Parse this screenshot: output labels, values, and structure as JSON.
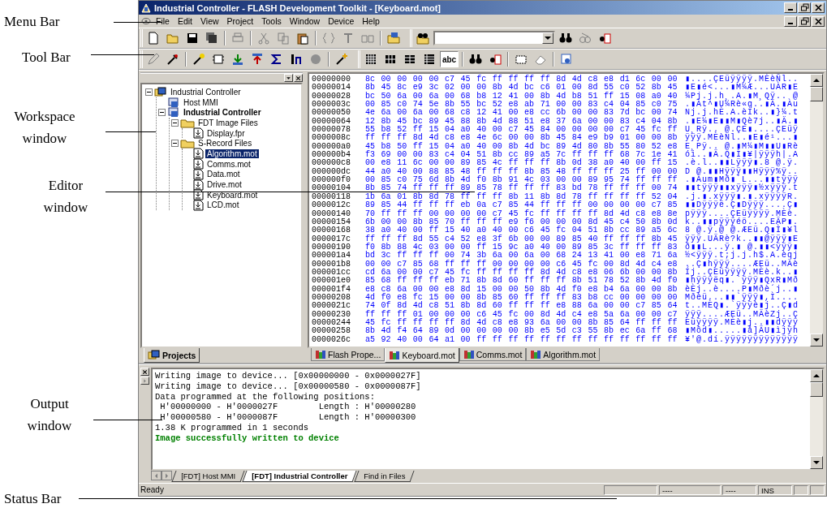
{
  "annotations": [
    {
      "label": "Menu Bar"
    },
    {
      "label": "Tool Bar"
    },
    {
      "label": "Workspace window"
    },
    {
      "label": "Editor window"
    },
    {
      "label": "Output window"
    },
    {
      "label": "Status Bar"
    }
  ],
  "window": {
    "title": "Industrial Controller - FLASH Development Toolkit - [Keyboard.mot]"
  },
  "menu": [
    "File",
    "Edit",
    "View",
    "Project",
    "Tools",
    "Window",
    "Device",
    "Help"
  ],
  "toolbar": {
    "abc_button": {
      "label": "abc",
      "selected": true
    }
  },
  "workspace": {
    "tree": [
      {
        "label": "Industrial Controller",
        "kind": "workspace",
        "active": false,
        "selected": false,
        "expanded": true,
        "children": [
          {
            "label": "Host MMI",
            "kind": "project",
            "active": false,
            "selected": false
          },
          {
            "label": "Industrial Controller",
            "kind": "project",
            "active": true,
            "selected": false,
            "expanded": true,
            "children": [
              {
                "label": "FDT Image Files",
                "kind": "folder",
                "active": false,
                "selected": false,
                "expanded": true,
                "children": [
                  {
                    "label": "Display.fpr",
                    "kind": "file",
                    "active": false,
                    "selected": false
                  }
                ]
              },
              {
                "label": "S-Record Files",
                "kind": "folder",
                "active": false,
                "selected": false,
                "expanded": true,
                "children": [
                  {
                    "label": "Algorithm.mot",
                    "kind": "file",
                    "active": false,
                    "selected": true
                  },
                  {
                    "label": "Comms.mot",
                    "kind": "file",
                    "active": false,
                    "selected": false
                  },
                  {
                    "label": "Data.mot",
                    "kind": "file",
                    "active": false,
                    "selected": false
                  },
                  {
                    "label": "Drive.mot",
                    "kind": "file",
                    "active": false,
                    "selected": false
                  },
                  {
                    "label": "Keyboard.mot",
                    "kind": "file",
                    "active": false,
                    "selected": false
                  },
                  {
                    "label": "LCD.mot",
                    "kind": "file",
                    "active": false,
                    "selected": false
                  }
                ]
              }
            ]
          }
        ]
      }
    ],
    "tabs": [
      {
        "label": "Projects",
        "selected": true
      }
    ]
  },
  "editor": {
    "rows": [
      {
        "address": "00000000",
        "bytes": "8c 00 00 00 00 c7 45 fc ff ff ff ff 8d 4d c8 e8 d1 6c 00 00",
        "ascii": "▮....ÇEüÿÿÿÿ.MÈèÑl.."
      },
      {
        "address": "00000014",
        "bytes": "8b 45 8c e9 3c 02 00 00 8b 4d bc c6 01 00 8d 55 c0 52 8b 45",
        "ascii": "▮E▮é<...▮M¼Æ...UÀR▮E"
      },
      {
        "address": "00000028",
        "bytes": "bc 50 6a 00 6a 00 68 b8 12 41 00 8b 4d b8 51 ff 15 08 a0 40",
        "ascii": "¼Pj.j.h¸.A.▮M¸Qÿ.. @"
      },
      {
        "address": "0000003c",
        "bytes": "00 85 c0 74 5e 8b 55 bc 52 e8 ab 71 00 00 83 c4 04 85 c0 75",
        "ascii": ".▮Àt^▮U¼Rè«q..▮Ä.▮Àu"
      },
      {
        "address": "00000050",
        "bytes": "4e 6a 00 6a 00 68 c8 12 41 00 e8 cc 6b 00 00 83 7d bc 00 74",
        "ascii": "Nj.j.hÈ.A.èÌk..▮}¼.t"
      },
      {
        "address": "00000064",
        "bytes": "12 8b 45 bc 89 45 88 8b 4d 88 51 e8 37 6a 00 00 83 c4 04 8b",
        "ascii": ".▮E¼▮E▮▮M▮Qè7j..▮Ä.▮"
      },
      {
        "address": "00000078",
        "bytes": "55 b8 52 ff 15 04 a0 40 00 c7 45 84 00 00 00 00 c7 45 fc ff",
        "ascii": "U¸Rÿ.. @.ÇE▮....ÇEüÿ"
      },
      {
        "address": "0000008c",
        "bytes": "ff ff ff 8d 4d c8 e8 4e 6c 00 00 8b 45 84 e9 b9 01 00 00 8b",
        "ascii": "ÿÿÿ.MÈèNl..▮E▮é¹...▮"
      },
      {
        "address": "000000a0",
        "bytes": "45 b8 50 ff 15 04 a0 40 00 8b 4d bc 89 4d 80 8b 55 80 52 e8",
        "ascii": "E¸Pÿ.. @.▮M¼▮M▮▮U▮Rè"
      },
      {
        "address": "000000b4",
        "bytes": "f3 69 00 00 83 c4 04 51 8b cc 89 a5 7c ff ff ff 68 7c 1e 41",
        "ascii": "ói..▮Ä.Q▮Ì▮¥|ÿÿÿh|.A"
      },
      {
        "address": "000000c8",
        "bytes": "00 e8 11 6c 00 00 89 85 4c ff ff ff 8b 0d 38 a0 40 00 ff 15",
        "ascii": ".è.l..▮▮Lÿÿÿ▮.8 @.ÿ."
      },
      {
        "address": "000000dc",
        "bytes": "44 a0 40 00 88 85 48 ff ff ff 8b 85 48 ff ff ff 25 ff 00 00",
        "ascii": "D @.▮▮Hÿÿÿ▮▮Hÿÿÿ%ÿ.."
      },
      {
        "address": "000000f0",
        "bytes": "00 85 c0 75 6d 8b 4d f0 8b 91 4c 03 00 00 89 95 74 ff ff ff",
        "ascii": ".▮Àum▮Mð▮´L...▮▮tÿÿÿ"
      },
      {
        "address": "00000104",
        "bytes": "8b 85 74 ff ff ff 89 85 78 ff ff ff 83 bd 78 ff ff ff 00 74",
        "ascii": "▮▮tÿÿÿ▮▮xÿÿÿ▮½xÿÿÿ.t"
      },
      {
        "address": "00000118",
        "bytes": "1b 6a 01 8b 8d 78 ff ff ff 8b 11 8b 8d 78 ff ff ff ff 52 04",
        "ascii": ".j.▮.xÿÿÿ▮.▮.xÿÿÿÿR."
      },
      {
        "address": "0000012c",
        "bytes": "89 85 44 ff ff ff eb 0a c7 85 44 ff ff ff 00 00 00 00 c7 85",
        "ascii": "▮▮Dÿÿÿë.Ç▮Dÿÿÿ....Ç▮"
      },
      {
        "address": "00000140",
        "bytes": "70 ff ff ff 00 00 00 00 c7 45 fc ff ff ff ff 8d 4d c8 e8 8e",
        "ascii": "pÿÿÿ....ÇEüÿÿÿÿ.MÈè."
      },
      {
        "address": "00000154",
        "bytes": "6b 00 00 8b 85 70 ff ff ff e9 f6 00 00 00 8d 45 c4 50 8b 0d",
        "ascii": "k..▮▮pÿÿÿéö....EÄP▮."
      },
      {
        "address": "00000168",
        "bytes": "38 a0 40 00 ff 15 40 a0 40 00 c6 45 fc 04 51 8b cc 89 a5 6c",
        "ascii": "8 @.ÿ.@ @.ÆEü.Q▮Ì▮¥l"
      },
      {
        "address": "0000017c",
        "bytes": "ff ff ff 8d 55 c4 52 e8 3f 6b 00 00 89 85 40 ff ff ff 8b 45",
        "ascii": "ÿÿÿ.UÄRè?k..▮▮@ÿÿÿ▮E"
      },
      {
        "address": "00000190",
        "bytes": "f0 8b 88 4c 03 00 00 ff 15 9c a0 40 00 89 85 3c ff ff ff 83",
        "ascii": "ð▮▮L...ÿ.▮ @.▮▮<ÿÿÿ▮"
      },
      {
        "address": "000001a4",
        "bytes": "bd 3c ff ff ff 00 74 3b 6a 00 6a 00 68 24 13 41 00 e8 71 6a",
        "ascii": "½<ÿÿÿ.t;j.j.h$.A.èqj"
      },
      {
        "address": "000001b8",
        "bytes": "00 00 c7 85 68 ff ff ff 00 00 00 00 c6 45 fc 00 8d 4d c4 e8",
        "ascii": "..Ç▮hÿÿÿ....ÆEü..MÄè"
      },
      {
        "address": "000001cc",
        "bytes": "cd 6a 00 00 c7 45 fc ff ff ff ff 8d 4d c8 e8 06 6b 00 00 8b",
        "ascii": "Íj..ÇEüÿÿÿÿ.MÈè.k..▮"
      },
      {
        "address": "000001e0",
        "bytes": "85 68 ff ff ff eb 71 8b 8d 60 ff ff ff 8b 51 78 52 8b 4d f0",
        "ascii": "▮hÿÿÿëq▮.`ÿÿÿ▮QxR▮Mð"
      },
      {
        "address": "000001f4",
        "bytes": "e8 c8 6a 00 00 e8 8d 15 00 00 50 8b 4d f0 e8 b4 6a 00 00 8b",
        "ascii": "èÈj..è....P▮Mðè´j..▮"
      },
      {
        "address": "00000208",
        "bytes": "4d f0 e8 fc 15 00 00 8b 85 60 ff ff ff 83 b8 cc 00 00 00 00",
        "ascii": "Mðèü...▮▮`ÿÿÿ▮,Ì...."
      },
      {
        "address": "0000021c",
        "bytes": "74 0f 8d 4d c8 51 8b 8d 60 ff ff ff e8 88 6a 00 00 c7 85 64",
        "ascii": "t..MÈQ▮.`ÿÿÿè▮j..Ç▮d"
      },
      {
        "address": "00000230",
        "bytes": "ff ff ff 01 00 00 00 c6 45 fc 00 8d 4d c4 e8 5a 6a 00 00 c7",
        "ascii": "ÿÿÿ....ÆEü..MÄèZj..Ç"
      },
      {
        "address": "00000244",
        "bytes": "45 fc ff ff ff ff 8d 4d c8 e8 93 6a 00 00 8b 85 64 ff ff ff",
        "ascii": "Eüÿÿÿÿ.MÈè▮j..▮▮dÿÿÿ"
      },
      {
        "address": "00000258",
        "bytes": "8b 4d f4 64 89 0d 00 00 00 00 8b e5 5d c3 55 8b ec 6a ff 68",
        "ascii": "▮Môd▮.....▮å]ÃU▮ìjÿh"
      },
      {
        "address": "0000026c",
        "bytes": "a5 92 40 00 64 a1 00 ff ff ff ff ff ff ff ff ff ff ff ff ff",
        "ascii": "¥'@.dí.ÿÿÿÿÿÿÿÿÿÿÿÿÿ"
      }
    ],
    "tabs": [
      {
        "label": "Flash Prope...",
        "selected": false
      },
      {
        "label": "Keyboard.mot",
        "selected": true
      },
      {
        "label": "Comms.mot",
        "selected": false
      },
      {
        "label": "Algorithm.mot",
        "selected": false
      }
    ]
  },
  "output": {
    "lines": [
      {
        "text": "Writing image to device... [0x00000000 - 0x0000027F]",
        "kind": "normal"
      },
      {
        "text": "Writing image to device... [0x00000580 - 0x0000087F]",
        "kind": "normal"
      },
      {
        "text": "Data programmed at the following positions:",
        "kind": "normal"
      },
      {
        "text": " H'00000000 - H'0000027F        Length : H'00000280",
        "kind": "normal"
      },
      {
        "text": " H'00000580 - H'0000087F        Length : H'00000300",
        "kind": "normal"
      },
      {
        "text": "1.38 K programmed in 1 seconds",
        "kind": "normal"
      },
      {
        "text": "Image successfully written to device",
        "kind": "success"
      }
    ],
    "tabs": [
      {
        "label": "[FDT] Host MMI",
        "selected": false
      },
      {
        "label": "[FDT] Industrial Controller",
        "selected": true
      },
      {
        "label": "Find in Files",
        "selected": false
      }
    ]
  },
  "status_bar": {
    "message": "Ready",
    "panes": [
      "----",
      "----",
      "INS"
    ]
  }
}
